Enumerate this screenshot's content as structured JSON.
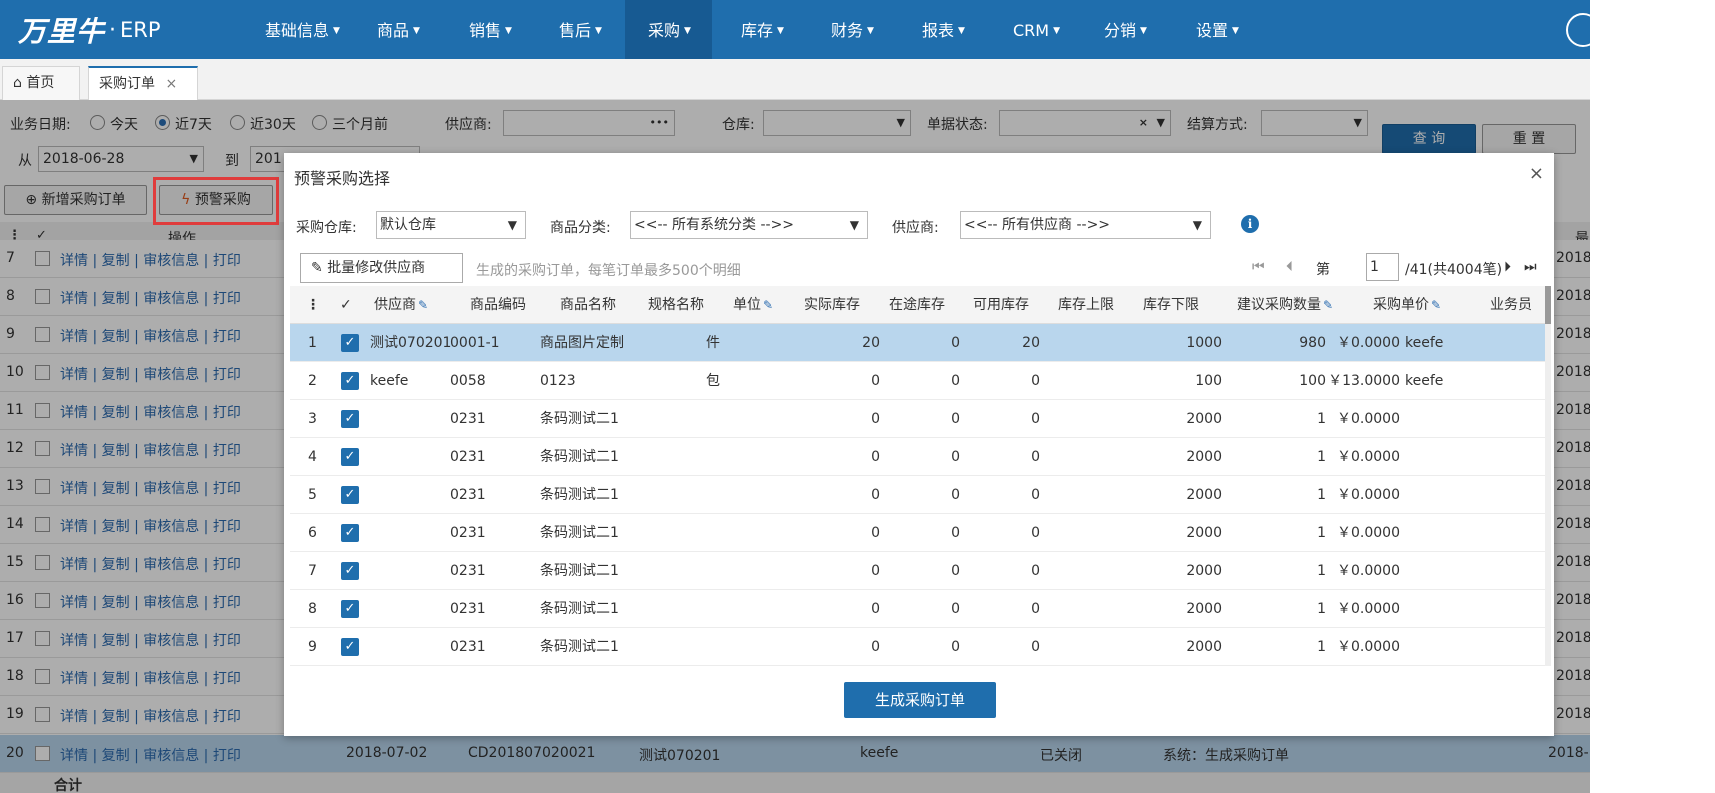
{
  "app": {
    "logo": "万里牛",
    "logo_sep": "·",
    "product": "ERP"
  },
  "nav": [
    {
      "label": "基础信息"
    },
    {
      "label": "商品"
    },
    {
      "label": "销售"
    },
    {
      "label": "售后"
    },
    {
      "label": "采购",
      "active": true
    },
    {
      "label": "库存"
    },
    {
      "label": "财务"
    },
    {
      "label": "报表"
    },
    {
      "label": "CRM"
    },
    {
      "label": "分销"
    },
    {
      "label": "设置"
    }
  ],
  "tabs": [
    {
      "label": "首页",
      "icon": "home-icon"
    },
    {
      "label": "采购订单",
      "close": "×"
    }
  ],
  "filters": {
    "business_date_label": "业务日期:",
    "radio_options": [
      "今天",
      "近7天",
      "近30天",
      "三个月前"
    ],
    "selected_radio": "近7天",
    "supplier_label": "供应商:",
    "supplier_value": "",
    "supplier_more": "•••",
    "warehouse_label": "仓库:",
    "status_label": "单据状态:",
    "status_clear": "×",
    "settlement_label": "结算方式:",
    "from_label": "从",
    "from_value": "2018-06-28",
    "to_label": "到",
    "to_value": "201",
    "query_button": "查 询",
    "reset_button": "重 置"
  },
  "toolbar": {
    "add_order": "新增采购订单",
    "warning_purchase": "预警采购"
  },
  "background_table": {
    "col_op": "操作",
    "col_last_partial": "最",
    "links": "详情 | 复制 | 审核信息 | 打印",
    "tail_prefix": "2018-",
    "row_numbers": [
      "7",
      "8",
      "9",
      "10",
      "11",
      "12",
      "13",
      "14",
      "15",
      "16",
      "17",
      "18",
      "19"
    ],
    "last_row": {
      "no": "20",
      "date": "2018-07-02",
      "order_no": "CD201807020021",
      "supplier": "测试070201",
      "user": "keefe",
      "status": "已关闭",
      "remark": "系统：生成采购订单",
      "tail": "2018-"
    },
    "footer_label": "合计"
  },
  "modal": {
    "title": "预警采购选择",
    "close": "×",
    "warehouse_label": "采购仓库:",
    "warehouse_value": "默认仓库",
    "category_label": "商品分类:",
    "category_value": "<<-- 所有系统分类 -->>",
    "supplier_label": "供应商:",
    "supplier_value": "<<-- 所有供应商 -->>",
    "batch_button": "批量修改供应商",
    "hint": "生成的采购订单，每笔订单最多500个明细",
    "pager": {
      "page_label": "第",
      "page": "1",
      "total": "/41(共4004笔)"
    },
    "columns": [
      "供应商",
      "商品编码",
      "商品名称",
      "规格名称",
      "单位",
      "实际库存",
      "在途库存",
      "可用库存",
      "库存上限",
      "库存下限",
      "建议采购数量",
      "采购单价",
      "业务员"
    ],
    "rows": [
      {
        "no": "1",
        "supplier": "测试070201",
        "code": "0001-1",
        "name": "商品图片定制",
        "spec": "",
        "unit": "件",
        "actual": "20",
        "transit": "0",
        "available": "20",
        "upper": "",
        "lower": "1000",
        "suggest": "980",
        "price": "￥0.0000",
        "salesman": "keefe"
      },
      {
        "no": "2",
        "supplier": "keefe",
        "code": "0058",
        "name": "0123",
        "spec": "",
        "unit": "包",
        "actual": "0",
        "transit": "0",
        "available": "0",
        "upper": "",
        "lower": "100",
        "suggest": "100",
        "price": "￥13.0000",
        "salesman": "keefe"
      },
      {
        "no": "3",
        "supplier": "",
        "code": "0231",
        "name": "条码测试二1",
        "spec": "",
        "unit": "",
        "actual": "0",
        "transit": "0",
        "available": "0",
        "upper": "",
        "lower": "2000",
        "suggest": "1",
        "price": "￥0.0000",
        "salesman": ""
      },
      {
        "no": "4",
        "supplier": "",
        "code": "0231",
        "name": "条码测试二1",
        "spec": "",
        "unit": "",
        "actual": "0",
        "transit": "0",
        "available": "0",
        "upper": "",
        "lower": "2000",
        "suggest": "1",
        "price": "￥0.0000",
        "salesman": ""
      },
      {
        "no": "5",
        "supplier": "",
        "code": "0231",
        "name": "条码测试二1",
        "spec": "",
        "unit": "",
        "actual": "0",
        "transit": "0",
        "available": "0",
        "upper": "",
        "lower": "2000",
        "suggest": "1",
        "price": "￥0.0000",
        "salesman": ""
      },
      {
        "no": "6",
        "supplier": "",
        "code": "0231",
        "name": "条码测试二1",
        "spec": "",
        "unit": "",
        "actual": "0",
        "transit": "0",
        "available": "0",
        "upper": "",
        "lower": "2000",
        "suggest": "1",
        "price": "￥0.0000",
        "salesman": ""
      },
      {
        "no": "7",
        "supplier": "",
        "code": "0231",
        "name": "条码测试二1",
        "spec": "",
        "unit": "",
        "actual": "0",
        "transit": "0",
        "available": "0",
        "upper": "",
        "lower": "2000",
        "suggest": "1",
        "price": "￥0.0000",
        "salesman": ""
      },
      {
        "no": "8",
        "supplier": "",
        "code": "0231",
        "name": "条码测试二1",
        "spec": "",
        "unit": "",
        "actual": "0",
        "transit": "0",
        "available": "0",
        "upper": "",
        "lower": "2000",
        "suggest": "1",
        "price": "￥0.0000",
        "salesman": ""
      },
      {
        "no": "9",
        "supplier": "",
        "code": "0231",
        "name": "条码测试二1",
        "spec": "",
        "unit": "",
        "actual": "0",
        "transit": "0",
        "available": "0",
        "upper": "",
        "lower": "2000",
        "suggest": "1",
        "price": "￥0.0000",
        "salesman": ""
      }
    ],
    "generate_button": "生成采购订单"
  },
  "colors": {
    "header_bg": "#1f6ead",
    "selected_row": "#b9d6ed",
    "link": "#2c6bb0",
    "highlight_border": "#e03c3c"
  }
}
